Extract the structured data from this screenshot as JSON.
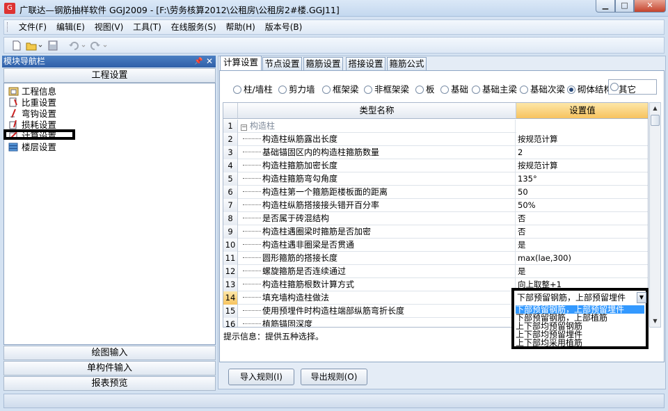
{
  "window": {
    "title": "广联达—钢筋抽样软件 GGJ2009 - [F:\\劳务核算2012\\公租房\\公租房2#楼.GGJ11]"
  },
  "menu": [
    "文件(F)",
    "编辑(E)",
    "视图(V)",
    "工具(T)",
    "在线服务(S)",
    "帮助(H)",
    "版本号(B)"
  ],
  "nav": {
    "title": "模块导航栏",
    "section": "工程设置",
    "items": [
      "工程信息",
      "比重设置",
      "弯钩设置",
      "损耗设置",
      "计算设置",
      "楼层设置"
    ],
    "bottom_buttons": [
      "绘图输入",
      "单构件输入",
      "报表预览"
    ]
  },
  "tabs": [
    "计算设置",
    "节点设置",
    "箍筋设置",
    "搭接设置",
    "箍筋公式"
  ],
  "radios": {
    "options": [
      "柱/墙柱",
      "剪力墙",
      "框架梁",
      "非框架梁",
      "板",
      "基础",
      "基础主梁",
      "基础次梁",
      "砌体结构"
    ],
    "selected": "砌体结构",
    "other": "其它"
  },
  "grid": {
    "col_name": "类型名称",
    "col_value": "设置值",
    "rows": [
      {
        "num": "1",
        "name": "构造柱",
        "value": ""
      },
      {
        "num": "2",
        "name": "构造柱纵筋露出长度",
        "value": "按规范计算"
      },
      {
        "num": "3",
        "name": "基础锚固区内的构造柱箍筋数量",
        "value": "2"
      },
      {
        "num": "4",
        "name": "构造柱箍筋加密长度",
        "value": "按规范计算"
      },
      {
        "num": "5",
        "name": "构造柱箍筋弯勾角度",
        "value": "135°"
      },
      {
        "num": "6",
        "name": "构造柱第一个箍筋距楼板面的距离",
        "value": "50"
      },
      {
        "num": "7",
        "name": "构造柱纵筋搭接接头错开百分率",
        "value": "50%"
      },
      {
        "num": "8",
        "name": "是否属于砖混结构",
        "value": "否"
      },
      {
        "num": "9",
        "name": "构造柱遇圈梁时箍筋是否加密",
        "value": "否"
      },
      {
        "num": "10",
        "name": "构造柱遇非圈梁是否贯通",
        "value": "是"
      },
      {
        "num": "11",
        "name": "圆形箍筋的搭接长度",
        "value": "max(lae,300)"
      },
      {
        "num": "12",
        "name": "螺旋箍筋是否连续通过",
        "value": "是"
      },
      {
        "num": "13",
        "name": "构造柱箍筋根数计算方式",
        "value": "向上取整+1"
      },
      {
        "num": "14",
        "name": "填充墙构造柱做法",
        "value": ""
      },
      {
        "num": "15",
        "name": "使用预埋件时构造柱端部纵筋弯折长度",
        "value": ""
      },
      {
        "num": "16",
        "name": "植筋锚固深度",
        "value": ""
      }
    ]
  },
  "dropdown": {
    "current": "下部预留钢筋，上部预留埋件",
    "options": [
      "下部预留钢筋，上部预留埋件",
      "下部预留钢筋，上部植筋",
      "上下部均预留钢筋",
      "上下部均预留埋件",
      "上下部均采用植筋"
    ]
  },
  "hint": "提示信息：提供五种选择。",
  "buttons": {
    "import": "导入规则(I)",
    "export": "导出规则(O)"
  }
}
